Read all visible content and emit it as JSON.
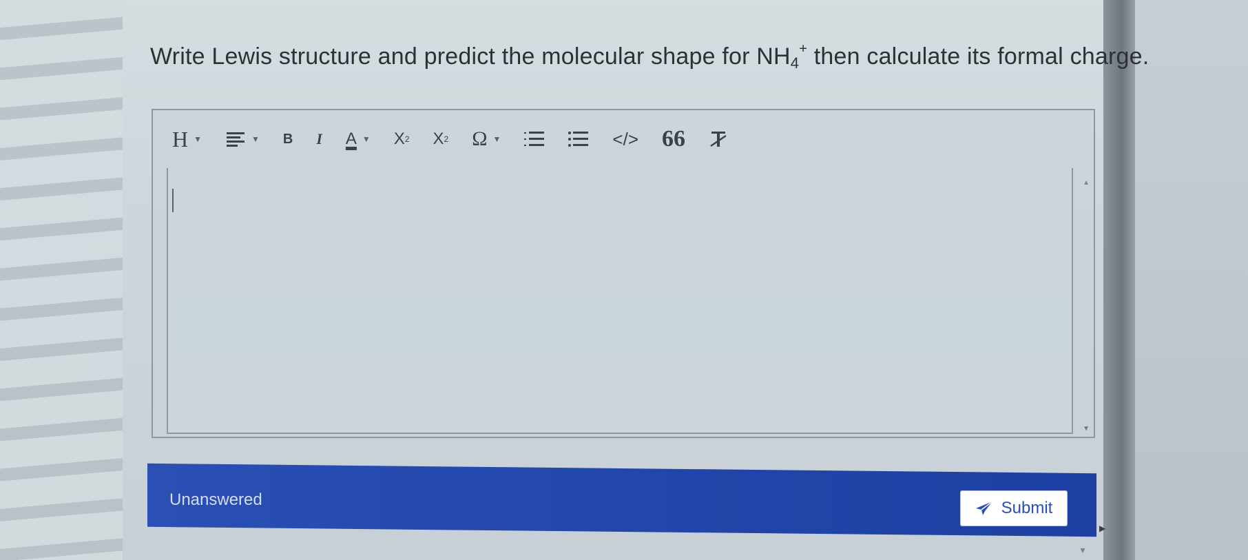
{
  "question": {
    "before": "Write Lewis structure and predict the molecular shape for ",
    "formula_main": "NH",
    "formula_sub": "4",
    "formula_sup": "+",
    "after": " then calculate its formal charge."
  },
  "toolbar": {
    "heading": "H",
    "bold": "B",
    "italic": "I",
    "font_color": "A",
    "subscript_base": "X",
    "subscript_small": "2",
    "superscript_base": "X",
    "superscript_small": "2",
    "special_chars": "Ω",
    "code": "</>",
    "blockquote": "66",
    "clear_format": "T"
  },
  "editor": {
    "content": ""
  },
  "footer": {
    "status": "Unanswered",
    "submit_label": "Submit"
  },
  "colors": {
    "footer_bg": "#2346aa",
    "submit_text": "#2a4fb4"
  }
}
